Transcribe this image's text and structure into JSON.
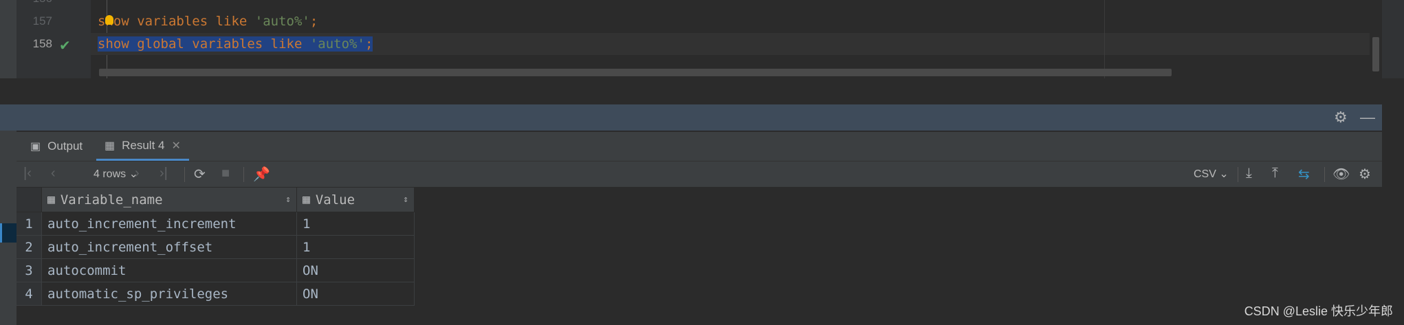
{
  "editor": {
    "lines": [
      {
        "number": "157",
        "code": "show variables like 'auto%';"
      },
      {
        "number": "158",
        "code": "show global variables like 'auto%';"
      }
    ],
    "status_icon": "checkmark-icon"
  },
  "tabs": [
    {
      "label": "Output",
      "icon": "output-icon"
    },
    {
      "label": "Result 4",
      "icon": "table-icon",
      "close": "✕"
    }
  ],
  "toolbar": {
    "rows_label": "4 rows",
    "export_format": "CSV"
  },
  "results": {
    "columns": [
      "Variable_name",
      "Value"
    ],
    "rows": [
      {
        "n": "1",
        "name": "auto_increment_increment",
        "value": "1"
      },
      {
        "n": "2",
        "name": "auto_increment_offset",
        "value": "1"
      },
      {
        "n": "3",
        "name": "autocommit",
        "value": "ON"
      },
      {
        "n": "4",
        "name": "automatic_sp_privileges",
        "value": "ON"
      }
    ]
  },
  "watermark": "CSDN @Leslie 快乐少年郎"
}
